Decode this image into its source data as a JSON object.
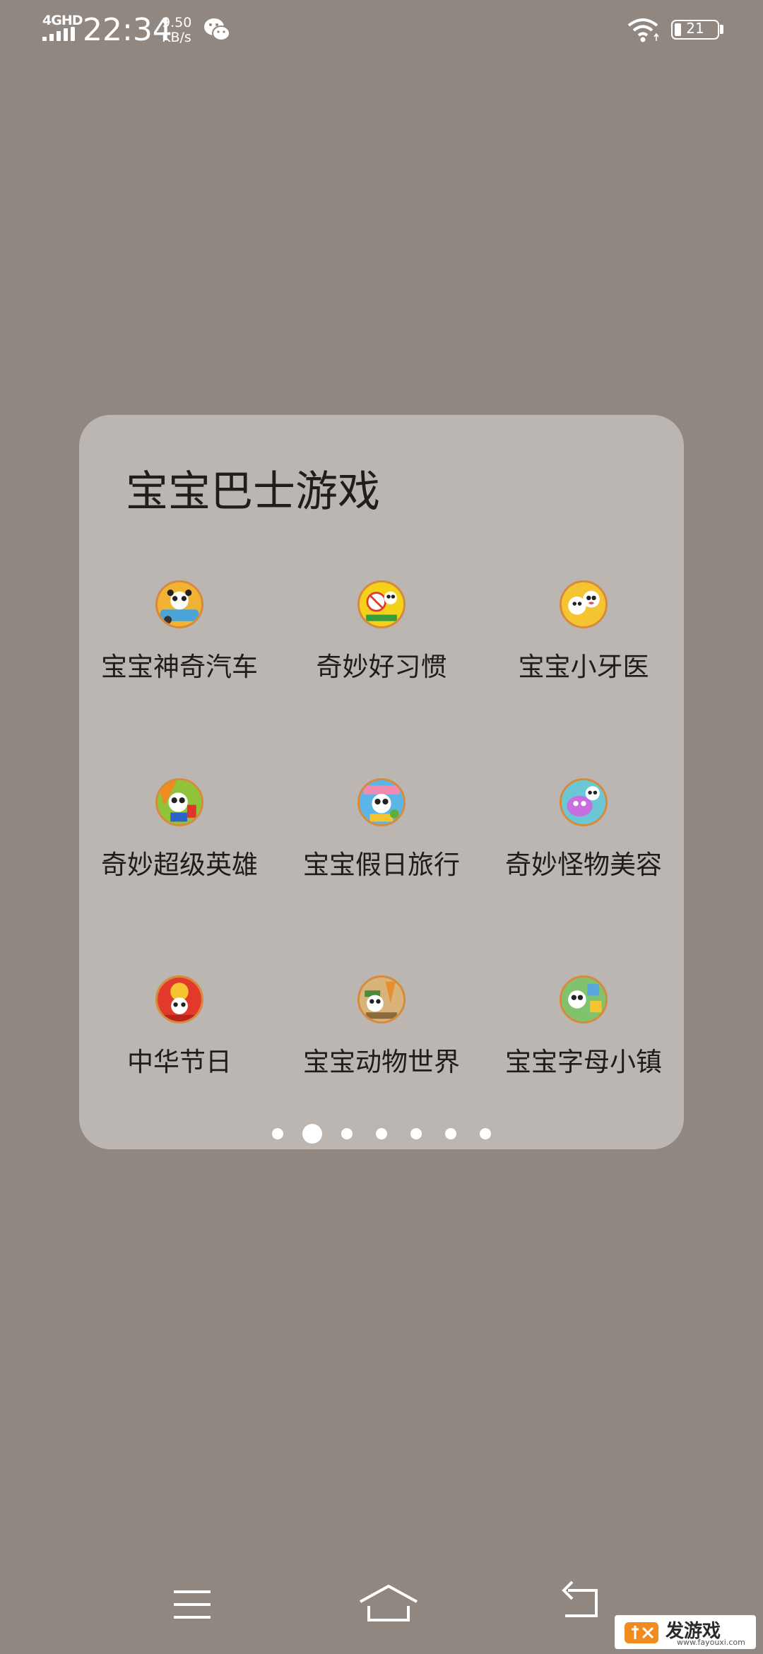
{
  "status_bar": {
    "network": "4GHD",
    "time": "22:34",
    "speed_value": "9.50",
    "speed_unit": "KB/s",
    "battery": "21",
    "icons": [
      "signal-icon",
      "wechat-icon",
      "wifi-icon",
      "battery-icon"
    ]
  },
  "folder": {
    "title": "宝宝巴士游戏",
    "apps": [
      {
        "label": "宝宝神奇汽车",
        "icon": "app-icon-car",
        "color": "#f2b233"
      },
      {
        "label": "奇妙好习惯",
        "icon": "app-icon-habits",
        "color": "#f5d11a"
      },
      {
        "label": "宝宝小牙医",
        "icon": "app-icon-dentist",
        "color": "#f4c431"
      },
      {
        "label": "奇妙超级英雄",
        "icon": "app-icon-hero",
        "color": "#8fc43a"
      },
      {
        "label": "宝宝假日旅行",
        "icon": "app-icon-holiday",
        "color": "#5bb4e6"
      },
      {
        "label": "奇妙怪物美容",
        "icon": "app-icon-monster",
        "color": "#c86fe0"
      },
      {
        "label": "中华节日",
        "icon": "app-icon-festival",
        "color": "#e23a2a"
      },
      {
        "label": "宝宝动物世界",
        "icon": "app-icon-animal",
        "color": "#e8902e"
      },
      {
        "label": "宝宝字母小镇",
        "icon": "app-icon-alphabet",
        "color": "#7fc36e"
      }
    ],
    "page_count": 7,
    "active_page": 2
  },
  "nav": {
    "icons": [
      "menu-icon",
      "home-icon",
      "back-icon"
    ]
  },
  "watermark": {
    "brand": "发游戏",
    "url": "www.fayouxi.com"
  }
}
